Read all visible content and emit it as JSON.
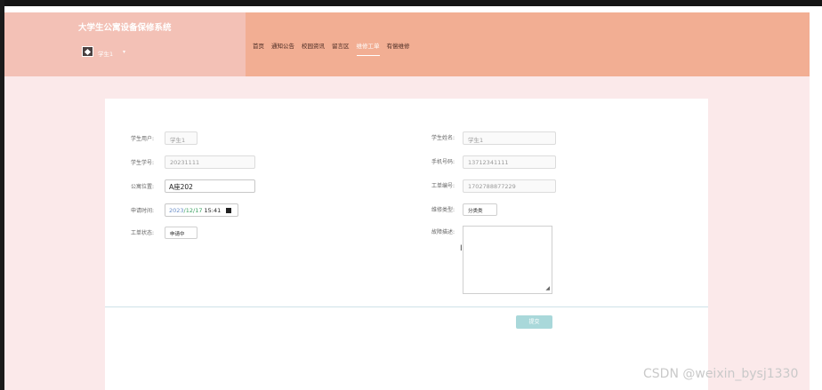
{
  "site": {
    "title": "大学生公寓设备保修系统",
    "username": "学生1",
    "caret": "▾"
  },
  "nav": {
    "items": [
      "首页",
      "通知公告",
      "校园资讯",
      "留言区",
      "维修工单",
      "有偿维修"
    ],
    "active_index": 4
  },
  "form": {
    "student_user_label": "学生用户:",
    "student_user_value": "学生1",
    "student_no_label": "学生学号:",
    "student_no_value": "20231111",
    "apt_location_label": "公寓位置:",
    "apt_location_value": "A座202",
    "apply_time_label": "申请时间:",
    "apply_time_year": "2023",
    "apply_time_md": "/12/17",
    "apply_time_hm": " 15:41",
    "order_status_label": "工单状态:",
    "order_status_value": "申请中",
    "student_name_label": "学生姓名:",
    "student_name_value": "学生1",
    "phone_label": "手机号码:",
    "phone_value": "13712341111",
    "order_no_label": "工单编号:",
    "order_no_value": "1702788877229",
    "repair_type_label": "维修类型:",
    "repair_type_value": "分类类",
    "fault_desc_label": "故障描述:",
    "submit_label": "提交"
  },
  "watermark": "CSDN @weixin_bysj1330",
  "colors": {
    "header_left": "#f3c1b6",
    "header_right": "#f2ae93",
    "page_bg": "#fbe9ea",
    "submit_bg": "#a9d8da"
  }
}
